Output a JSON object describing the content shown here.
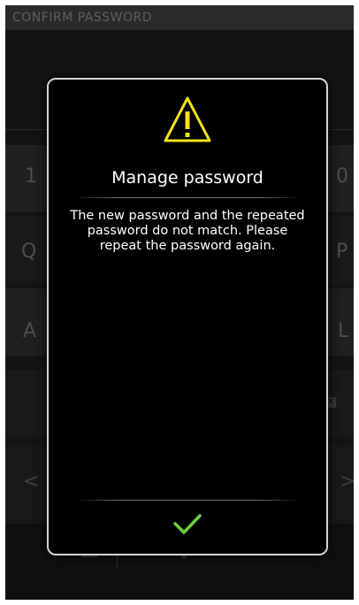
{
  "header": {
    "title": "CONFIRM PASSWORD"
  },
  "keyboard": {
    "row1_left": "1",
    "row1_right": "0",
    "row2_left": "Q",
    "row2_right": "P",
    "row3_left": "A",
    "row3_right": "L",
    "backspace_icon": "backspace-icon",
    "nav_left": "<",
    "nav_right": ">"
  },
  "dialog": {
    "icon": "warning-icon",
    "title": "Manage password",
    "message": "The new password and the repeated password do not match. Please repeat the password again.",
    "confirm_icon": "check-icon"
  },
  "colors": {
    "warning": "#f1e316",
    "confirm": "#6fcf3f",
    "dialog_border": "#d4d4d4",
    "text": "#ffffff"
  }
}
